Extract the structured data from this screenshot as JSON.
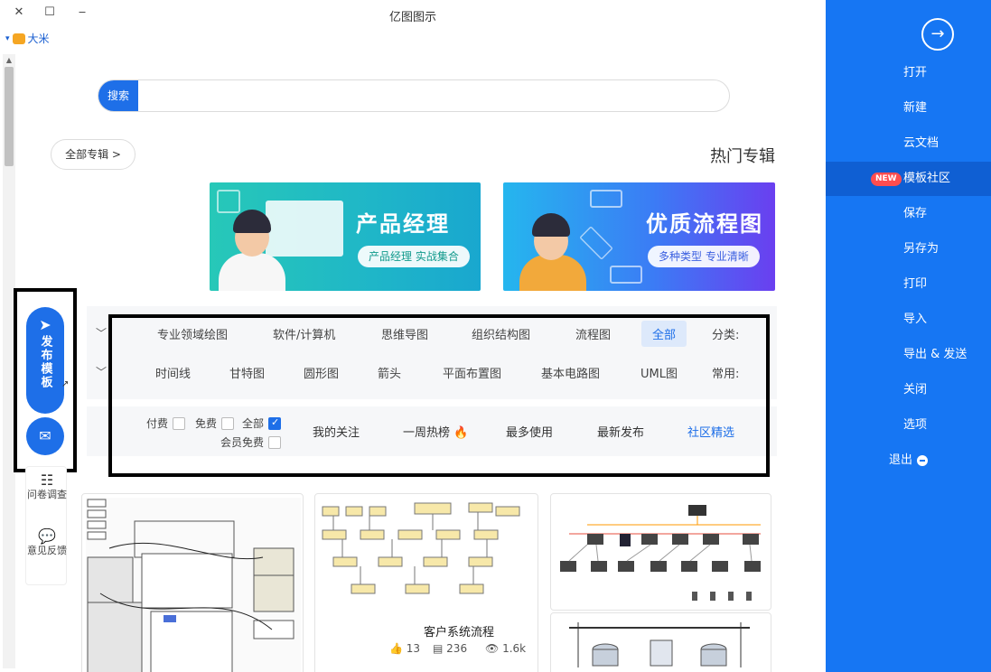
{
  "window": {
    "title": "亿图图示",
    "close": "✕",
    "maximize": "☐",
    "minimize": "‒"
  },
  "user": {
    "name": "大米",
    "dropdown": "▾"
  },
  "search": {
    "button": "搜索",
    "value": "",
    "placeholder": ""
  },
  "albums": {
    "all_label": "全部专辑 >",
    "hot_title": "热门专辑"
  },
  "banners": [
    {
      "title": "产品经理",
      "subtitle": "产品经理 实战集合"
    },
    {
      "title": "优质流程图",
      "subtitle": "多种类型 专业清晰"
    }
  ],
  "filter": {
    "category_label": "分类:",
    "categories": [
      "全部",
      "流程图",
      "组织结构图",
      "思维导图",
      "软件/计算机",
      "专业领域绘图"
    ],
    "common_label": "常用:",
    "common": [
      "UML图",
      "基本电路图",
      "平面布置图",
      "箭头",
      "圆形图",
      "甘特图",
      "时间线"
    ],
    "tabs": [
      "社区精选",
      "最新发布",
      "最多使用",
      "一周热榜",
      "我的关注"
    ],
    "checkboxes": [
      {
        "label": "全部",
        "checked": true
      },
      {
        "label": "免费",
        "checked": false
      },
      {
        "label": "付费",
        "checked": false
      },
      {
        "label": "会员免费",
        "checked": false
      }
    ]
  },
  "floating": {
    "publish": "发布模板",
    "help": [
      {
        "label": "问卷调查"
      },
      {
        "label": "意见反馈"
      }
    ]
  },
  "cards": [
    {
      "title": "",
      "views": "",
      "likes": "",
      "copies": ""
    },
    {
      "title": "客户系统流程",
      "views": "1.6k",
      "copies": "236",
      "likes": "13"
    },
    {
      "title": "",
      "views": "",
      "likes": "",
      "copies": ""
    }
  ],
  "sidebar": {
    "items": [
      {
        "label": "打开"
      },
      {
        "label": "新建"
      },
      {
        "label": "云文档"
      },
      {
        "label": "模板社区",
        "badge": "NEW",
        "active": true
      },
      {
        "label": "保存"
      },
      {
        "label": "另存为"
      },
      {
        "label": "打印"
      },
      {
        "label": "导入"
      },
      {
        "label": "导出 & 发送"
      },
      {
        "label": "关闭"
      },
      {
        "label": "选项"
      },
      {
        "label": "退出"
      }
    ]
  },
  "colors": {
    "accent": "#1e6fe8",
    "sidebar": "#1676f3",
    "badge": "#ff4d4f"
  }
}
